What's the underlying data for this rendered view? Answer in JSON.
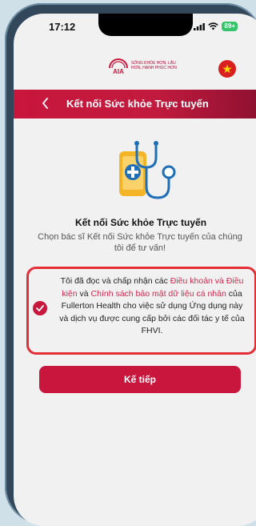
{
  "status_bar": {
    "time": "17:12",
    "battery": "89+"
  },
  "brand": {
    "logo": "AIA",
    "tagline": "SỐNG KHỎE HƠN, LÂU HƠN, HẠNH PHÚC HƠN"
  },
  "header": {
    "title": "Kết nối Sức khỏe Trực tuyến"
  },
  "main": {
    "title": "Kết nối Sức khỏe Trực tuyến",
    "subtitle": "Chọn bác sĩ Kết nối Sức khỏe Trực tuyến của chúng tôi để tư vấn!"
  },
  "consent": {
    "checked": true,
    "text_1": "Tôi đã đọc và chấp nhận các ",
    "link_terms": "Điều khoản và Điều kiện",
    "text_2": " và ",
    "link_privacy": "Chính sách bảo mật dữ liệu cá nhân",
    "text_3": " của Fullerton Health cho việc sử dụng Ứng dụng này và dịch vụ được cung cấp bởi các đối tác y tế của FHVI."
  },
  "actions": {
    "next_label": "Kế tiếp"
  },
  "colors": {
    "brand_red": "#c8163c",
    "highlight_border": "#e32f37"
  },
  "icons": {
    "back": "chevron-left-icon",
    "flag": "vietnam-flag-icon",
    "check": "check-circle-icon",
    "illustration": "stethoscope-phone-icon"
  }
}
